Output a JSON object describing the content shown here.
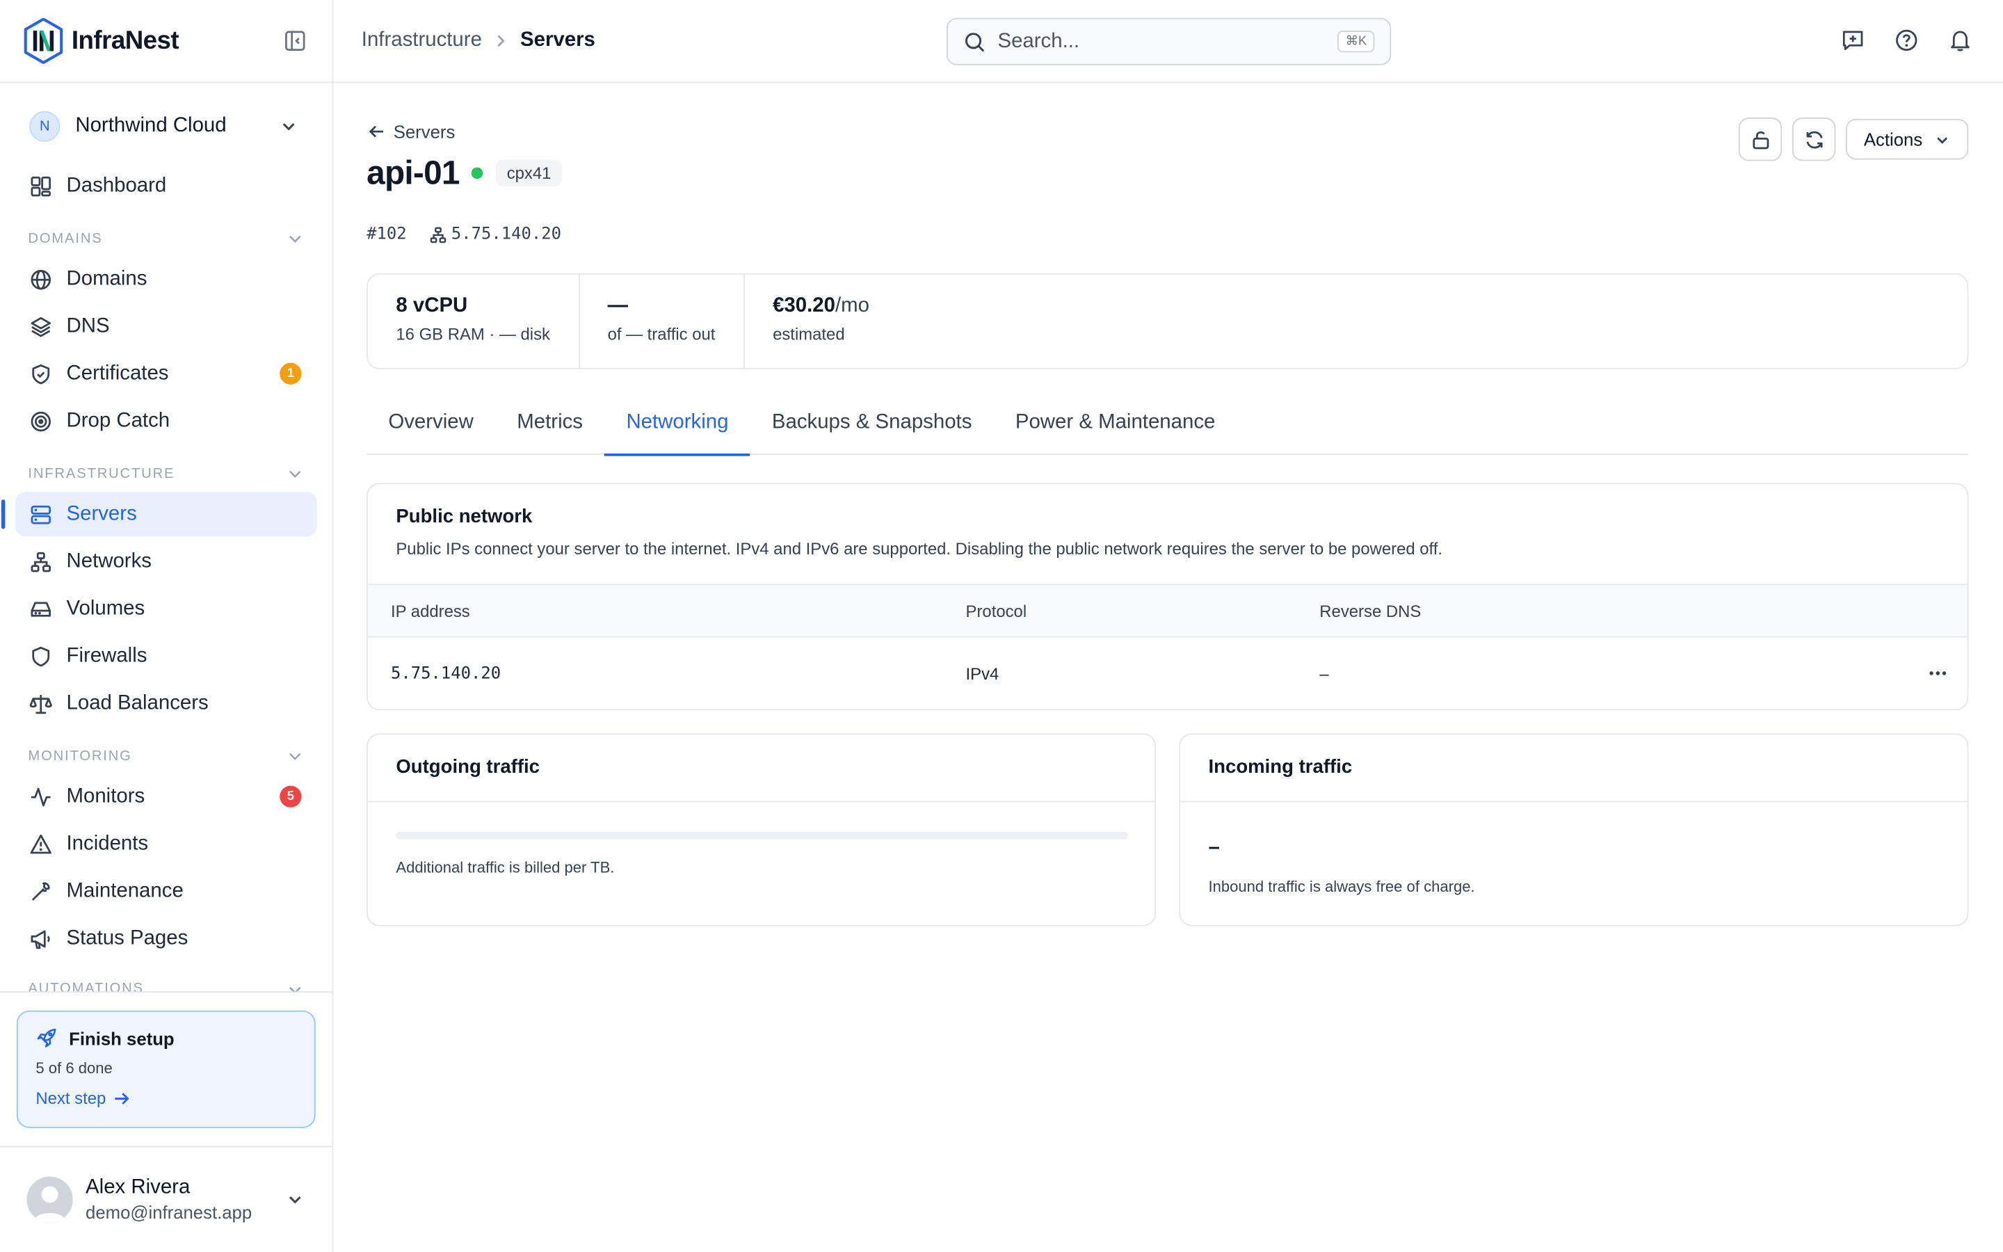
{
  "app": {
    "name": "InfraNest",
    "brand_color": "#2563eb"
  },
  "org": {
    "initial": "N",
    "name": "Northwind Cloud"
  },
  "nav": {
    "dashboard": "Dashboard",
    "sections": {
      "domains": "DOMAINS",
      "infrastructure": "INFRASTRUCTURE",
      "monitoring": "MONITORING",
      "automations": "AUTOMATIONS"
    },
    "domains_items": [
      {
        "label": "Domains",
        "icon": "globe-icon"
      },
      {
        "label": "DNS",
        "icon": "layers-icon"
      },
      {
        "label": "Certificates",
        "icon": "shield-check-icon",
        "badge": "1",
        "badge_color": "#f59e0b"
      },
      {
        "label": "Drop Catch",
        "icon": "target-icon"
      }
    ],
    "infra_items": [
      {
        "label": "Servers",
        "icon": "server-icon",
        "active": true
      },
      {
        "label": "Networks",
        "icon": "network-icon"
      },
      {
        "label": "Volumes",
        "icon": "hard-drive-icon"
      },
      {
        "label": "Firewalls",
        "icon": "shield-icon"
      },
      {
        "label": "Load Balancers",
        "icon": "scale-icon"
      }
    ],
    "monitoring_items": [
      {
        "label": "Monitors",
        "icon": "activity-icon",
        "badge": "5",
        "badge_color": "#ef4444"
      },
      {
        "label": "Incidents",
        "icon": "alert-triangle-icon"
      },
      {
        "label": "Maintenance",
        "icon": "wrench-icon"
      },
      {
        "label": "Status Pages",
        "icon": "megaphone-icon"
      }
    ]
  },
  "setup": {
    "title": "Finish setup",
    "progress": "5 of 6 done",
    "next": "Next step"
  },
  "user": {
    "name": "Alex Rivera",
    "email": "demo@infranest.app"
  },
  "topbar": {
    "breadcrumb": [
      "Infrastructure",
      "Servers"
    ],
    "search_placeholder": "Search...",
    "search_shortcut": "⌘K"
  },
  "server": {
    "back_label": "Servers",
    "name": "api-01",
    "status_color": "#22c55e",
    "type": "cpx41",
    "id": "#102",
    "ip": "5.75.140.20",
    "actions_label": "Actions"
  },
  "stats": [
    {
      "value": "8 vCPU",
      "sub": "16 GB RAM · — disk"
    },
    {
      "value": "—",
      "sub": "of — traffic out"
    },
    {
      "value": "€30.20",
      "unit": "/mo",
      "sub": "estimated"
    }
  ],
  "tabs": [
    "Overview",
    "Metrics",
    "Networking",
    "Backups & Snapshots",
    "Power & Maintenance"
  ],
  "active_tab": "Networking",
  "public_network": {
    "title": "Public network",
    "description": "Public IPs connect your server to the internet. IPv4 and IPv6 are supported. Disabling the public network requires the server to be powered off.",
    "columns": [
      "IP address",
      "Protocol",
      "Reverse DNS"
    ],
    "rows": [
      {
        "ip": "5.75.140.20",
        "protocol": "IPv4",
        "rdns": "–"
      }
    ]
  },
  "outgoing": {
    "title": "Outgoing traffic",
    "usage_fraction": 0,
    "note": "Additional traffic is billed per TB."
  },
  "incoming": {
    "title": "Incoming traffic",
    "value": "–",
    "note": "Inbound traffic is always free of charge."
  }
}
